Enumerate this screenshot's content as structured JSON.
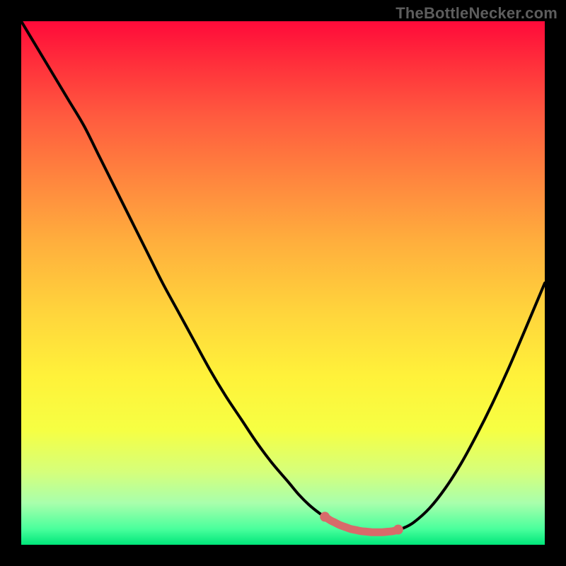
{
  "watermark": "TheBottleNecker.com",
  "chart_data": {
    "type": "line",
    "title": "",
    "xlabel": "",
    "ylabel": "",
    "xlim": [
      0,
      100
    ],
    "ylim": [
      0,
      100
    ],
    "x": [
      0,
      3,
      6,
      9,
      12,
      15,
      18,
      21,
      24,
      27,
      30,
      33,
      36,
      39,
      42,
      45,
      48,
      51,
      53,
      55,
      57,
      59,
      61,
      63,
      65,
      67,
      69,
      71,
      73,
      75,
      78,
      81,
      84,
      87,
      90,
      93,
      96,
      100
    ],
    "values": [
      100,
      95,
      90,
      85,
      80,
      74,
      68,
      62,
      56,
      50,
      44.5,
      39,
      33.5,
      28.5,
      24,
      19.5,
      15.5,
      12,
      9.6,
      7.6,
      6.0,
      4.7,
      3.7,
      3.0,
      2.6,
      2.4,
      2.4,
      2.6,
      3.2,
      4.3,
      7.0,
      10.8,
      15.5,
      21.0,
      27.0,
      33.5,
      40.5,
      50
    ],
    "highlight": {
      "x_start": 58,
      "x_end": 72
    },
    "background_gradient": {
      "top": "#ff0a3a",
      "bottom": "#00e67a",
      "via": [
        "#ffd33c",
        "#fff23a"
      ]
    }
  },
  "colors": {
    "curve": "#000000",
    "marker": "#d86a6a",
    "frame": "#000000"
  }
}
